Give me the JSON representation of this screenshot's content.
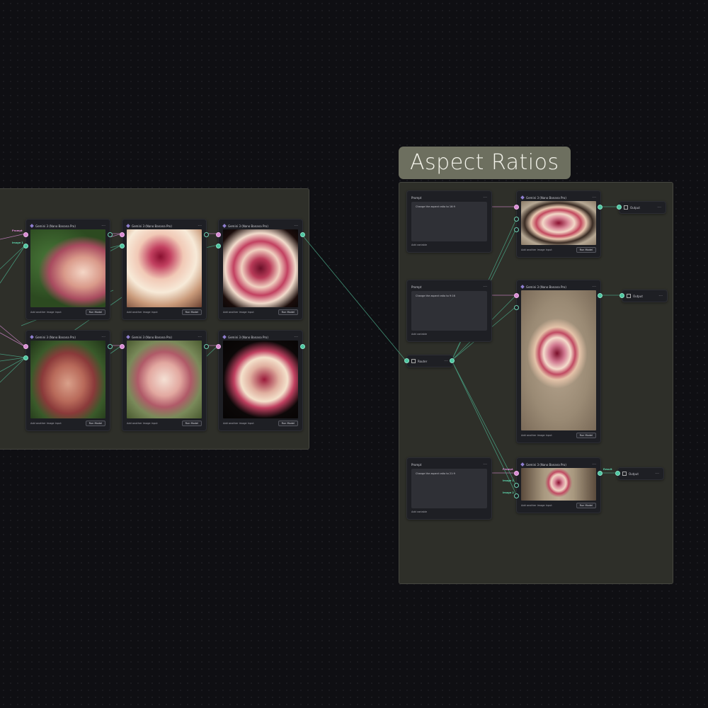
{
  "group": {
    "title": "Aspect Ratios"
  },
  "model_node": {
    "title": "Gemini 3 (Nano Banana Pro)",
    "add_input": "Add another image input",
    "run_label": "Run Model",
    "menu": "···"
  },
  "ports": {
    "prompt": "Prompt",
    "image1": "Image 1",
    "image2": "Image 2",
    "result": "Result"
  },
  "prompt_node": {
    "title": "Prompt",
    "add_variable": "Add variable",
    "prompts": [
      "Change the aspect ratio to 16:9",
      "Change the aspect ratio to 9:16",
      "Change the aspect ratio to 21:9"
    ]
  },
  "router": {
    "label": "Router"
  },
  "output": {
    "label": "Output"
  },
  "colors": {
    "canvas": "#0f0f13",
    "group_bg": "#2e2f29",
    "group_label": "#6d6f5f",
    "pink_port": "#d78ad2",
    "green_port": "#4dc5a0"
  }
}
